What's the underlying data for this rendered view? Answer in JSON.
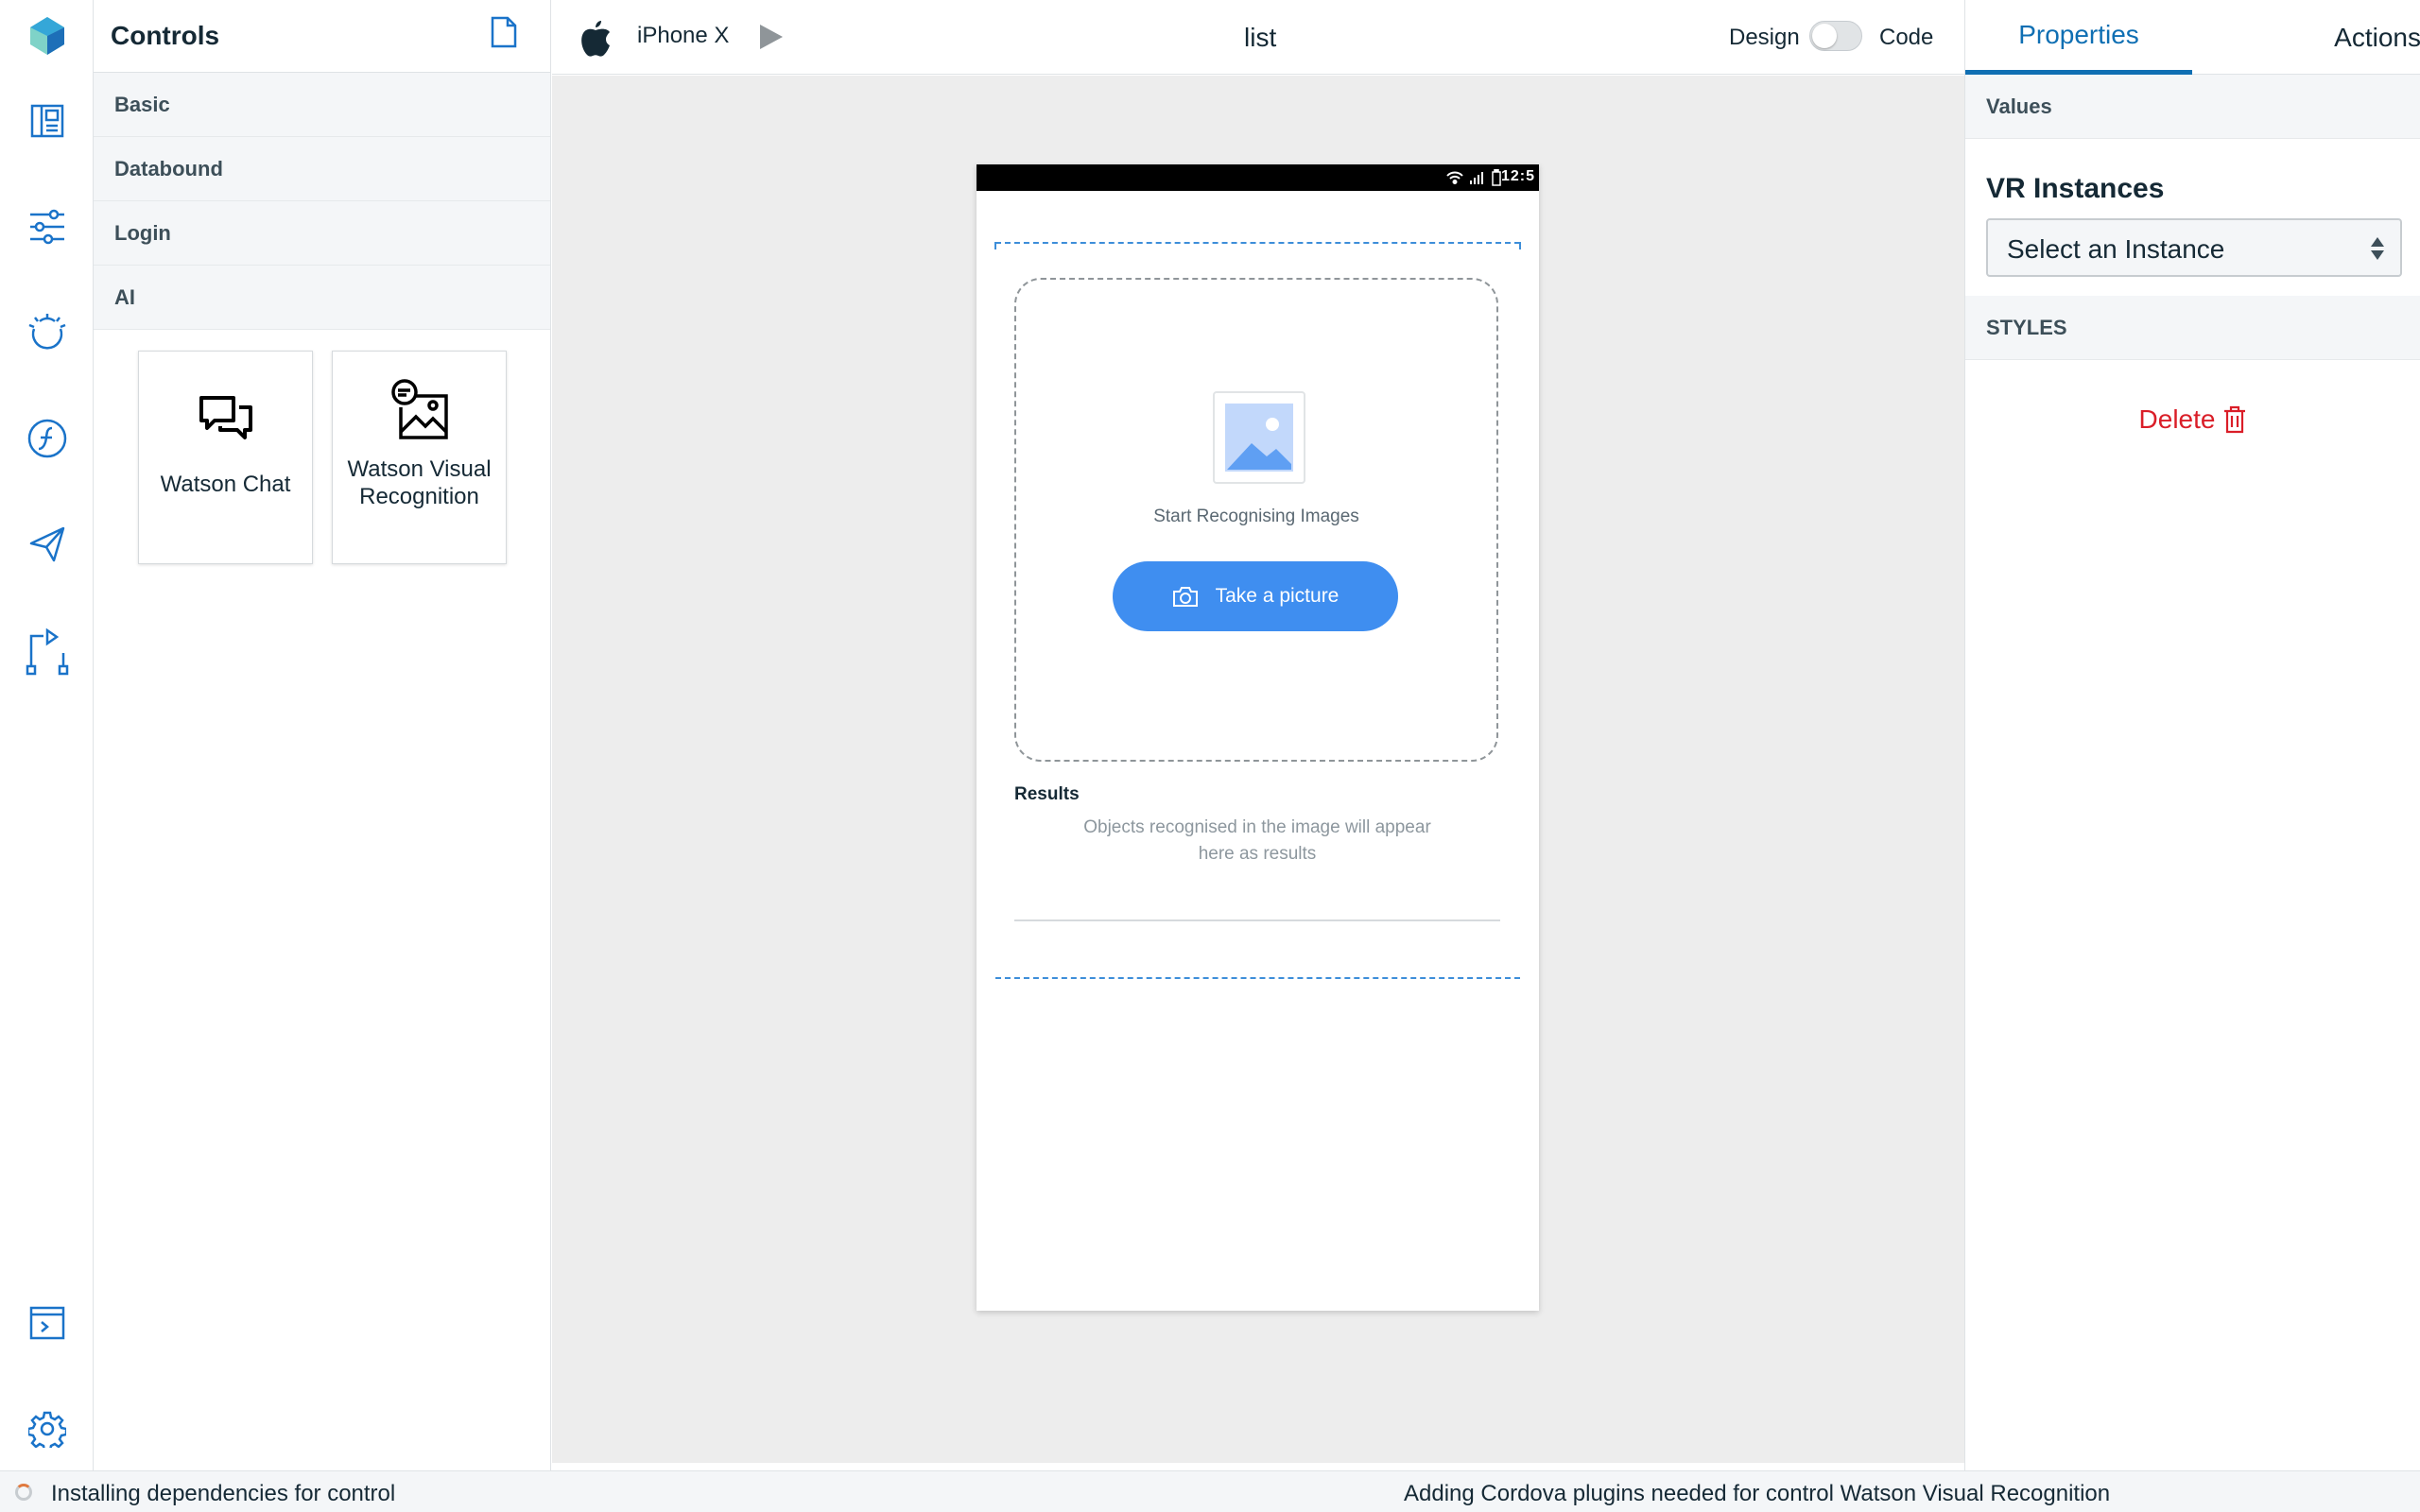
{
  "controls": {
    "title": "Controls",
    "categories": [
      {
        "label": "Basic"
      },
      {
        "label": "Databound"
      },
      {
        "label": "Login"
      },
      {
        "label": "AI"
      }
    ],
    "ai_items": [
      {
        "label": "Watson Chat",
        "icon": "chat-icon"
      },
      {
        "label": "Watson Visual Recognition",
        "icon": "visual-recognition-icon"
      }
    ]
  },
  "rail": {
    "icons": [
      "app-logo-icon",
      "layout-icon",
      "sliders-icon",
      "watson-icon",
      "functions-icon",
      "send-icon",
      "flow-icon",
      "terminal-icon",
      "gear-icon"
    ]
  },
  "toolbar": {
    "device": "iPhone X",
    "page_name": "list",
    "design_label": "Design",
    "code_label": "Code",
    "mode_is_code": false
  },
  "phone": {
    "status_time": "12:5",
    "vr_title": "Start Recognising Images",
    "button_label": "Take a picture",
    "results_title": "Results",
    "results_hint": "Objects recognised in the image will appear here as results"
  },
  "properties": {
    "tabs": [
      {
        "label": "Properties",
        "active": true
      },
      {
        "label": "Actions",
        "active": false
      }
    ],
    "values_section": "Values",
    "vr_heading": "VR Instances",
    "select_value": "Select an Instance",
    "styles_section": "STYLES",
    "delete_label": "Delete"
  },
  "statusbar": {
    "left": "Installing dependencies for control",
    "right": "Adding Cordova plugins needed for control Watson Visual Recognition"
  },
  "colors": {
    "accent": "#0f6fb3",
    "button": "#3f8ef0",
    "delete": "#da1e28",
    "selection": "#3d8ed9"
  }
}
